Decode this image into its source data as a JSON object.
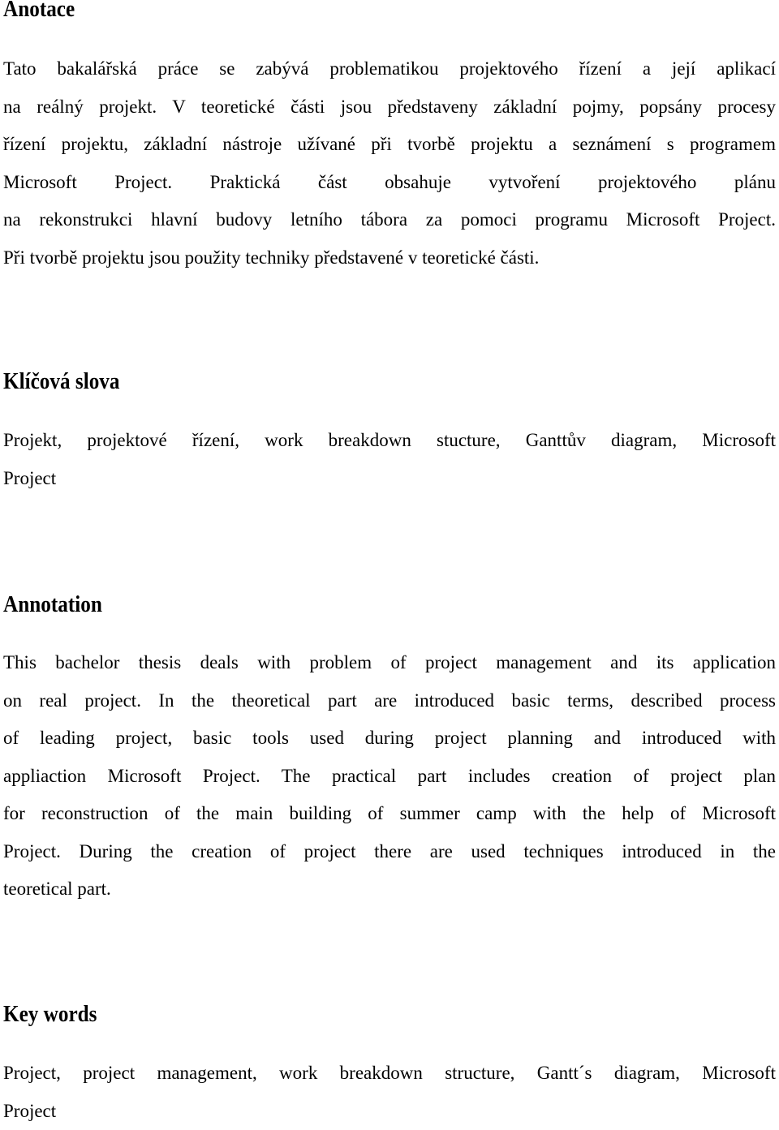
{
  "sections": {
    "anotace": {
      "heading": "Anotace",
      "lines": [
        "Tato bakalářská práce se zabývá problematikou projektového řízení a její aplikací",
        "na reálný projekt. V teoretické části jsou představeny základní pojmy, popsány procesy",
        "řízení projektu, základní nástroje užívané při tvorbě projektu a seznámení s programem",
        "Microsoft Project. Praktická část obsahuje vytvoření projektového plánu",
        "na rekonstrukci hlavní budovy letního tábora za pomoci programu Microsoft Project.",
        "Při tvorbě projektu jsou použity techniky představené v teoretické části."
      ]
    },
    "klicova_slova": {
      "heading": "Klíčová slova",
      "lines": [
        "Projekt, projektové řízení, work breakdown stucture, Ganttův diagram, Microsoft",
        "Project"
      ]
    },
    "annotation": {
      "heading": "Annotation",
      "lines": [
        "This bachelor thesis deals with problem of project management and its application",
        "on real project. In the theoretical part are introduced basic terms, described process",
        "of leading project, basic tools used during project planning and introduced with",
        "appliaction Microsoft Project. The practical part includes creation of project plan",
        "for reconstruction of the main building of summer camp with the help of Microsoft",
        "Project. During the creation of project there are used techniques introduced in the",
        "teoretical part."
      ]
    },
    "key_words": {
      "heading": "Key words",
      "lines": [
        "Project, project management, work breakdown structure, Gantt´s diagram, Microsoft",
        "Project"
      ]
    }
  }
}
